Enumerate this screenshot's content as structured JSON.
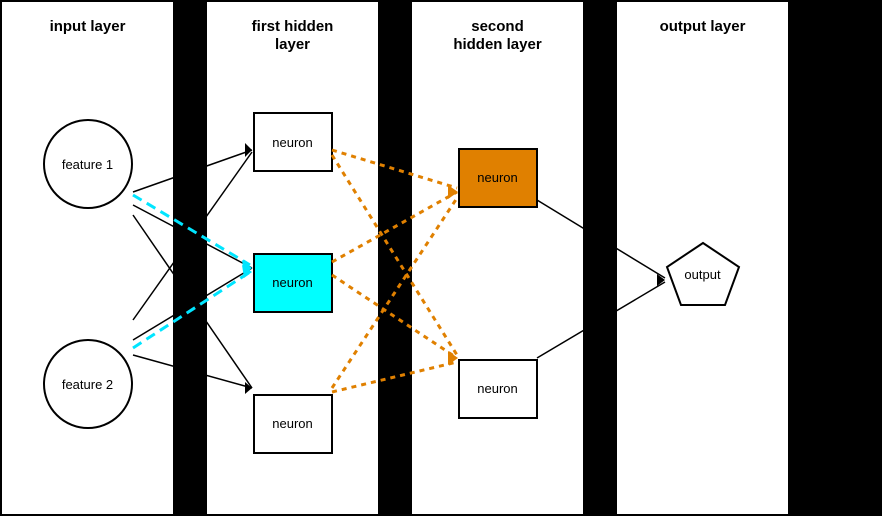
{
  "layers": {
    "input": {
      "title": "input layer",
      "nodes": [
        {
          "label": "feature 1",
          "type": "circle"
        },
        {
          "label": "feature 2",
          "type": "circle"
        }
      ]
    },
    "firstHidden": {
      "title": "first hidden\nlayer",
      "nodes": [
        {
          "label": "neuron",
          "type": "square",
          "style": "normal"
        },
        {
          "label": "neuron",
          "type": "square",
          "style": "cyan"
        },
        {
          "label": "neuron",
          "type": "square",
          "style": "normal"
        }
      ]
    },
    "secondHidden": {
      "title": "second\nhidden layer",
      "nodes": [
        {
          "label": "neuron",
          "type": "square",
          "style": "orange"
        },
        {
          "label": "neuron",
          "type": "square",
          "style": "normal"
        }
      ]
    },
    "output": {
      "title": "output layer",
      "nodes": [
        {
          "label": "output",
          "type": "pentagon"
        }
      ]
    }
  },
  "colors": {
    "cyan": "#00e5ff",
    "orange": "#e08000",
    "dashed_cyan": "#00e5ff",
    "dotted_orange": "#e08000",
    "black": "#000000",
    "white": "#ffffff"
  }
}
